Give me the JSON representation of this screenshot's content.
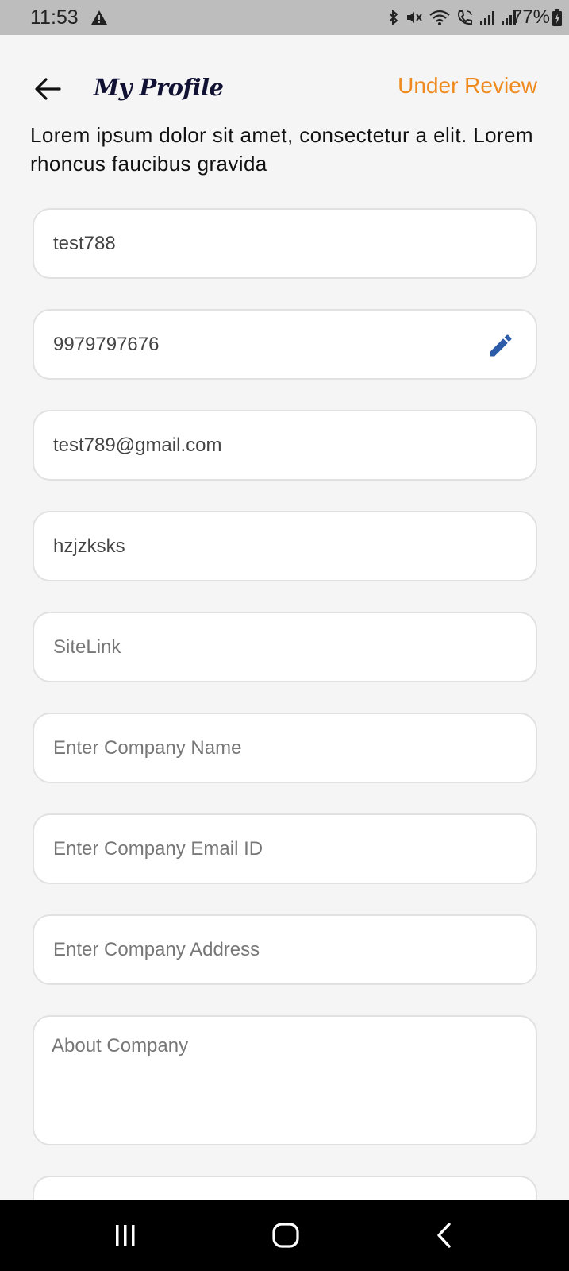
{
  "status_bar": {
    "time": "11:53",
    "battery": "77%",
    "icons": [
      "warning-icon",
      "bluetooth-icon",
      "mute-icon",
      "wifi-icon",
      "wifi-calling-icon",
      "signal-icon",
      "signal-icon",
      "battery-charging-icon"
    ]
  },
  "header": {
    "back_icon": "arrow-left-icon",
    "title": "My Profile",
    "status": "Under Review",
    "status_color": "#ef8a1e"
  },
  "description": "Lorem ipsum dolor sit amet, consectetur a elit. Lorem rhoncus faucibus gravida",
  "form": {
    "username": {
      "value": "test788",
      "placeholder": ""
    },
    "phone": {
      "value": "9979797676",
      "placeholder": "",
      "edit_icon": "pencil-icon",
      "edit_color": "#2c5ba8"
    },
    "email": {
      "value": "test789@gmail.com",
      "placeholder": ""
    },
    "location": {
      "value": "hzjzksks",
      "placeholder": ""
    },
    "site_link": {
      "value": "",
      "placeholder": "SiteLink"
    },
    "company_name": {
      "value": "",
      "placeholder": "Enter Company Name"
    },
    "company_email": {
      "value": "",
      "placeholder": "Enter Company Email ID"
    },
    "company_address": {
      "value": "",
      "placeholder": "Enter Company Address"
    },
    "about_company": {
      "value": "",
      "placeholder": "About Company"
    }
  },
  "nav_bar": {
    "buttons": [
      "recent-apps-icon",
      "home-icon",
      "back-icon"
    ]
  }
}
